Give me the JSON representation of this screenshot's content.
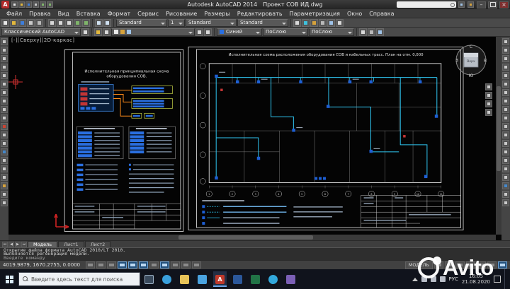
{
  "window": {
    "app_title": "Autodesk AutoCAD 2014",
    "doc_title": "Проект СОВ ИД.dwg"
  },
  "menu": {
    "items": [
      "Файл",
      "Правка",
      "Вид",
      "Вставка",
      "Формат",
      "Сервис",
      "Рисование",
      "Размеры",
      "Редактировать",
      "Параметризация",
      "Окно",
      "Справка"
    ]
  },
  "toolbar": {
    "text_style": "Standard",
    "scale": "1",
    "dim_style": "Standard",
    "table_style": "Standard",
    "workspace": "Классический AutoCAD",
    "color": "Синий",
    "linetype": "ПоСлою",
    "lineweight": "ПоСлою"
  },
  "canvas": {
    "viewport_controls": "[-][Сверху][2D-каркас]"
  },
  "viewcube": {
    "n": "С",
    "s": "Ю",
    "w": "З",
    "e": "В",
    "top": "Верх"
  },
  "sheets": {
    "left": {
      "title1": "Исполнительная принципиальная схема",
      "title2": "оборудования СОВ."
    },
    "right": {
      "title": "Исполнительная схема расположения оборудования СОВ и кабельных трасс. План на отм. 0,000",
      "bubbles": [
        "1",
        "2",
        "3",
        "4",
        "5",
        "6",
        "7",
        "8",
        "9",
        "10",
        "11"
      ]
    }
  },
  "layout_tabs": {
    "model": "Модель",
    "l1": "Лист1",
    "l2": "Лист2"
  },
  "command": {
    "history1": "Открытие файла формата AutoCAD 2010/LT 2010.",
    "history2": "Выполняется регенерация модели.",
    "prompt": "Введите команду"
  },
  "status": {
    "coords": "4019.9879, 1670.2755, 0.0000",
    "model": "МОДЕЛЬ"
  },
  "taskbar": {
    "search": "Введите здесь текст для поиска",
    "lang": "РУС",
    "time": "16:05",
    "date": "21.08.2020"
  },
  "watermark": {
    "brand": "Avito"
  },
  "colors": {
    "accent_blue": "#2a6fe0",
    "cable_cyan": "#2fc6f2",
    "cable_orange": "#ff8c1a",
    "sheet_line": "#e8e8e8"
  }
}
